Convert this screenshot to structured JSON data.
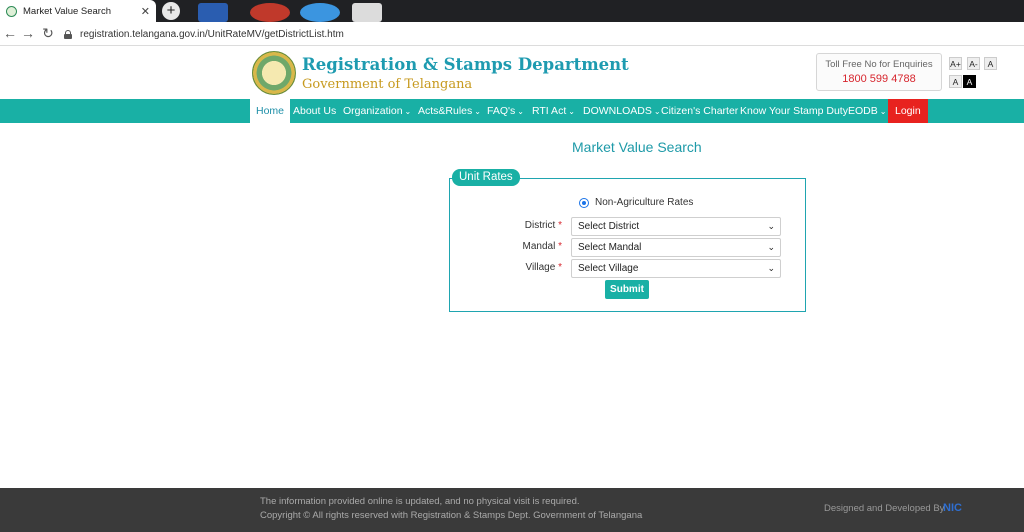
{
  "browser": {
    "tab_title": "Market Value Search",
    "url": "registration.telangana.gov.in/UnitRateMV/getDistrictList.htm",
    "new_tab_symbol": "+",
    "close_symbol": "✕"
  },
  "header": {
    "dept_title": "Registration & Stamps Department",
    "govt_title": "Government of Telangana",
    "tollfree_label": "Toll Free No for Enquiries",
    "tollfree_number": "1800 599 4788",
    "font_controls": [
      "A+",
      "A-",
      "A"
    ],
    "contrast_controls": [
      "A",
      "A"
    ]
  },
  "nav": {
    "items": [
      {
        "label": "Home",
        "dropdown": false
      },
      {
        "label": "About Us",
        "dropdown": false
      },
      {
        "label": "Organization",
        "dropdown": true
      },
      {
        "label": "Acts&Rules",
        "dropdown": true
      },
      {
        "label": "FAQ's",
        "dropdown": true
      },
      {
        "label": "RTI Act",
        "dropdown": true
      },
      {
        "label": "DOWNLOADS",
        "dropdown": true
      },
      {
        "label": "Citizen's Charter",
        "dropdown": false
      },
      {
        "label": "Know Your Stamp Duty",
        "dropdown": false
      },
      {
        "label": "EODB",
        "dropdown": true
      },
      {
        "label": "Login",
        "dropdown": false
      }
    ]
  },
  "main": {
    "page_title": "Market Value Search",
    "legend": "Unit Rates",
    "radio_label": "Non-Agriculture Rates",
    "fields": [
      {
        "label": "District",
        "value": "Select District"
      },
      {
        "label": "Mandal",
        "value": "Select Mandal"
      },
      {
        "label": "Village",
        "value": "Select Village"
      }
    ],
    "required_mark": "*",
    "submit_label": "Submit"
  },
  "footer": {
    "line1": "The information provided online is updated, and no physical visit is required.",
    "line2": "Copyright © All rights reserved with Registration & Stamps Dept. Government of Telangana",
    "credit": "Designed and Developed By",
    "nic": "NIC"
  },
  "colors": {
    "teal": "#19b0a5",
    "title_blue": "#1e9bb0",
    "gold": "#c79a1e",
    "login_red": "#e8221f",
    "footer_bg": "#3a3a3a"
  }
}
